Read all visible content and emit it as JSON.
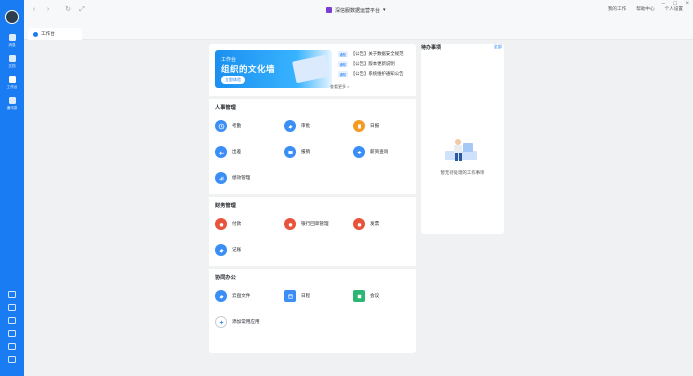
{
  "rail": {
    "items": [
      {
        "label": "消息"
      },
      {
        "label": "文档"
      },
      {
        "label": "工作台"
      },
      {
        "label": "通讯录"
      }
    ]
  },
  "titlebar": {
    "app_title": "深信服数据运营平台",
    "actions": [
      "我的工作",
      "帮助中心",
      "个人设置"
    ]
  },
  "tab": {
    "label": "工作台"
  },
  "banner": {
    "small": "工作台",
    "headline": "组织的文化墙",
    "button": "立即体验"
  },
  "notices": [
    {
      "tag": "通知",
      "text": "【公告】关于数据安全规范"
    },
    {
      "tag": "通知",
      "text": "【公告】版本更新说明"
    },
    {
      "tag": "通知",
      "text": "【公告】系统维护通知公告"
    }
  ],
  "more_label": "查看更多 >",
  "sections": [
    {
      "title": "人事管理",
      "apps": [
        {
          "name": "考勤",
          "color": "#3a8ef6"
        },
        {
          "name": "审批",
          "color": "#3a8ef6"
        },
        {
          "name": "日报",
          "color": "#f59a23"
        },
        {
          "name": "出差",
          "color": "#3a8ef6"
        },
        {
          "name": "报销",
          "color": "#3a8ef6"
        },
        {
          "name": "薪资查询",
          "color": "#3a8ef6"
        },
        {
          "name": "绩效管理",
          "color": "#3a8ef6"
        }
      ]
    },
    {
      "title": "财务管理",
      "apps": [
        {
          "name": "付款",
          "color": "#e8533c"
        },
        {
          "name": "银行回单管理",
          "color": "#e8533c"
        },
        {
          "name": "发票",
          "color": "#e8533c"
        },
        {
          "name": "记账",
          "color": "#3a8ef6"
        }
      ]
    },
    {
      "title": "协同办公",
      "apps": [
        {
          "name": "云盘文件",
          "color": "#3a8ef6"
        },
        {
          "name": "日程",
          "color": "#3a8ef6"
        },
        {
          "name": "会议",
          "color": "#2bb673"
        },
        {
          "name": "添加常用应用",
          "color": "#ffffff"
        }
      ]
    }
  ],
  "side": {
    "title": "待办事项",
    "link": "全部",
    "empty_text": "暂无待处理的工作事项"
  }
}
